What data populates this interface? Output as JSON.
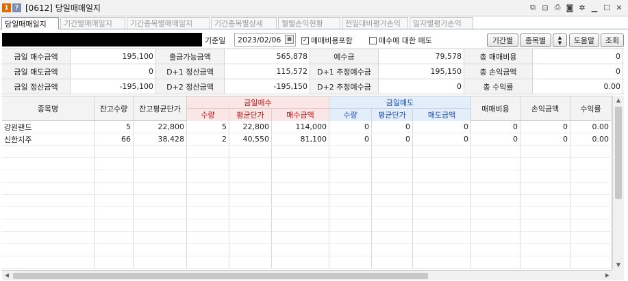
{
  "window": {
    "code": "[0612]",
    "title": "당일매매일지",
    "badge_one": "1",
    "badge_help": "?"
  },
  "tabs": [
    {
      "label": "당일매매일지",
      "active": true
    },
    {
      "label": "기간별매매일지",
      "active": false
    },
    {
      "label": "기간종목별매매일지",
      "active": false
    },
    {
      "label": "기간종목별상세",
      "active": false
    },
    {
      "label": "월별손익현황",
      "active": false
    },
    {
      "label": "전일대비평가손익",
      "active": false
    },
    {
      "label": "일자별평가손익",
      "active": false
    }
  ],
  "toolbar": {
    "date_label": "기준일",
    "date_value": "2023/02/06",
    "include_fee_label": "매매비용포함",
    "include_fee_checked": true,
    "sell_on_buy_label": "매수에 대한 매도",
    "sell_on_buy_checked": false,
    "by_period_label": "기간별",
    "by_stock_label": "종목별",
    "help_label": "도움말",
    "query_label": "조회"
  },
  "summary": [
    [
      {
        "label": "금일 매수금액",
        "value": "195,100"
      },
      {
        "label": "출금가능금액",
        "value": "565,878"
      },
      {
        "label": "예수금",
        "value": "79,578"
      },
      {
        "label": "총 매매비용",
        "value": "0"
      }
    ],
    [
      {
        "label": "금일 매도금액",
        "value": "0"
      },
      {
        "label": "D+1 정산금액",
        "value": "115,572"
      },
      {
        "label": "D+1 추정예수금",
        "value": "195,150"
      },
      {
        "label": "총 손익금액",
        "value": "0"
      }
    ],
    [
      {
        "label": "금일 정산금액",
        "value": "-195,100"
      },
      {
        "label": "D+2 정산금액",
        "value": "-195,150"
      },
      {
        "label": "D+2 추정예수금",
        "value": "0"
      },
      {
        "label": "총 수익률",
        "value": "0.00"
      }
    ]
  ],
  "grid": {
    "headers": {
      "name": "종목명",
      "qty": "잔고수량",
      "avg_price": "잔고평균단가",
      "buy_group": "금일매수",
      "sell_group": "금일매도",
      "sub_qty": "수량",
      "sub_avg": "평균단가",
      "buy_amount": "매수금액",
      "sell_amount": "매도금액",
      "fee": "매매비용",
      "pnl": "손익금액",
      "rate": "수익률"
    },
    "rows": [
      [
        "강원랜드",
        "5",
        "22,800",
        "5",
        "22,800",
        "114,000",
        "0",
        "0",
        "0",
        "0",
        "0",
        "0.00"
      ],
      [
        "신한지주",
        "66",
        "38,428",
        "2",
        "40,550",
        "81,100",
        "0",
        "0",
        "0",
        "0",
        "0",
        "0.00"
      ]
    ],
    "empty_rows": 10
  }
}
